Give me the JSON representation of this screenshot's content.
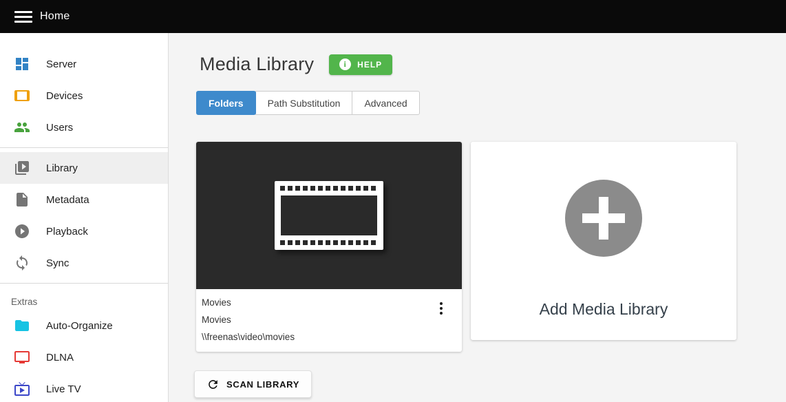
{
  "topbar": {
    "title": "Home"
  },
  "sidebar": {
    "items": [
      {
        "label": "Server",
        "icon": "dashboard-icon",
        "color": "#3283c5",
        "active": false
      },
      {
        "label": "Devices",
        "icon": "tablet-icon",
        "color": "#efa00b",
        "active": false
      },
      {
        "label": "Users",
        "icon": "users-icon",
        "color": "#49a33e",
        "active": false
      },
      {
        "label": "Library",
        "icon": "video-library-icon",
        "color": "#757575",
        "active": true
      },
      {
        "label": "Metadata",
        "icon": "file-icon",
        "color": "#757575",
        "active": false
      },
      {
        "label": "Playback",
        "icon": "play-circle-icon",
        "color": "#757575",
        "active": false
      },
      {
        "label": "Sync",
        "icon": "sync-icon",
        "color": "#757575",
        "active": false
      }
    ],
    "section_label": "Extras",
    "extras": [
      {
        "label": "Auto-Organize",
        "icon": "folder-icon",
        "color": "#17c3e3",
        "active": false
      },
      {
        "label": "DLNA",
        "icon": "tv-icon",
        "color": "#e53935",
        "active": false
      },
      {
        "label": "Live TV",
        "icon": "live-tv-icon",
        "color": "#3b46c8",
        "active": false
      }
    ]
  },
  "header": {
    "title": "Media Library",
    "help_label": "HELP",
    "help_icon": "info-icon"
  },
  "tabs": [
    {
      "label": "Folders",
      "active": true
    },
    {
      "label": "Path Substitution",
      "active": false
    },
    {
      "label": "Advanced",
      "active": false
    }
  ],
  "library_card": {
    "thumbnail_icon": "film-strip-icon",
    "name": "Movies",
    "content_type": "Movies",
    "path": "\\\\freenas\\video\\movies",
    "menu_icon": "vertical-dots-icon"
  },
  "add_card": {
    "label": "Add Media Library",
    "icon": "plus-circle-icon"
  },
  "actions": {
    "scan_label": "SCAN LIBRARY",
    "scan_icon": "refresh-icon"
  },
  "colors": {
    "topbar_bg": "#0a0a0a",
    "active_tab_blue": "#3e8acc",
    "help_green": "#52b54b",
    "card_image_bg": "#2a2a2a",
    "add_circle_gray": "#8b8b8b",
    "main_bg": "#f4f4f4",
    "sidebar_active_bg": "#efefef"
  }
}
